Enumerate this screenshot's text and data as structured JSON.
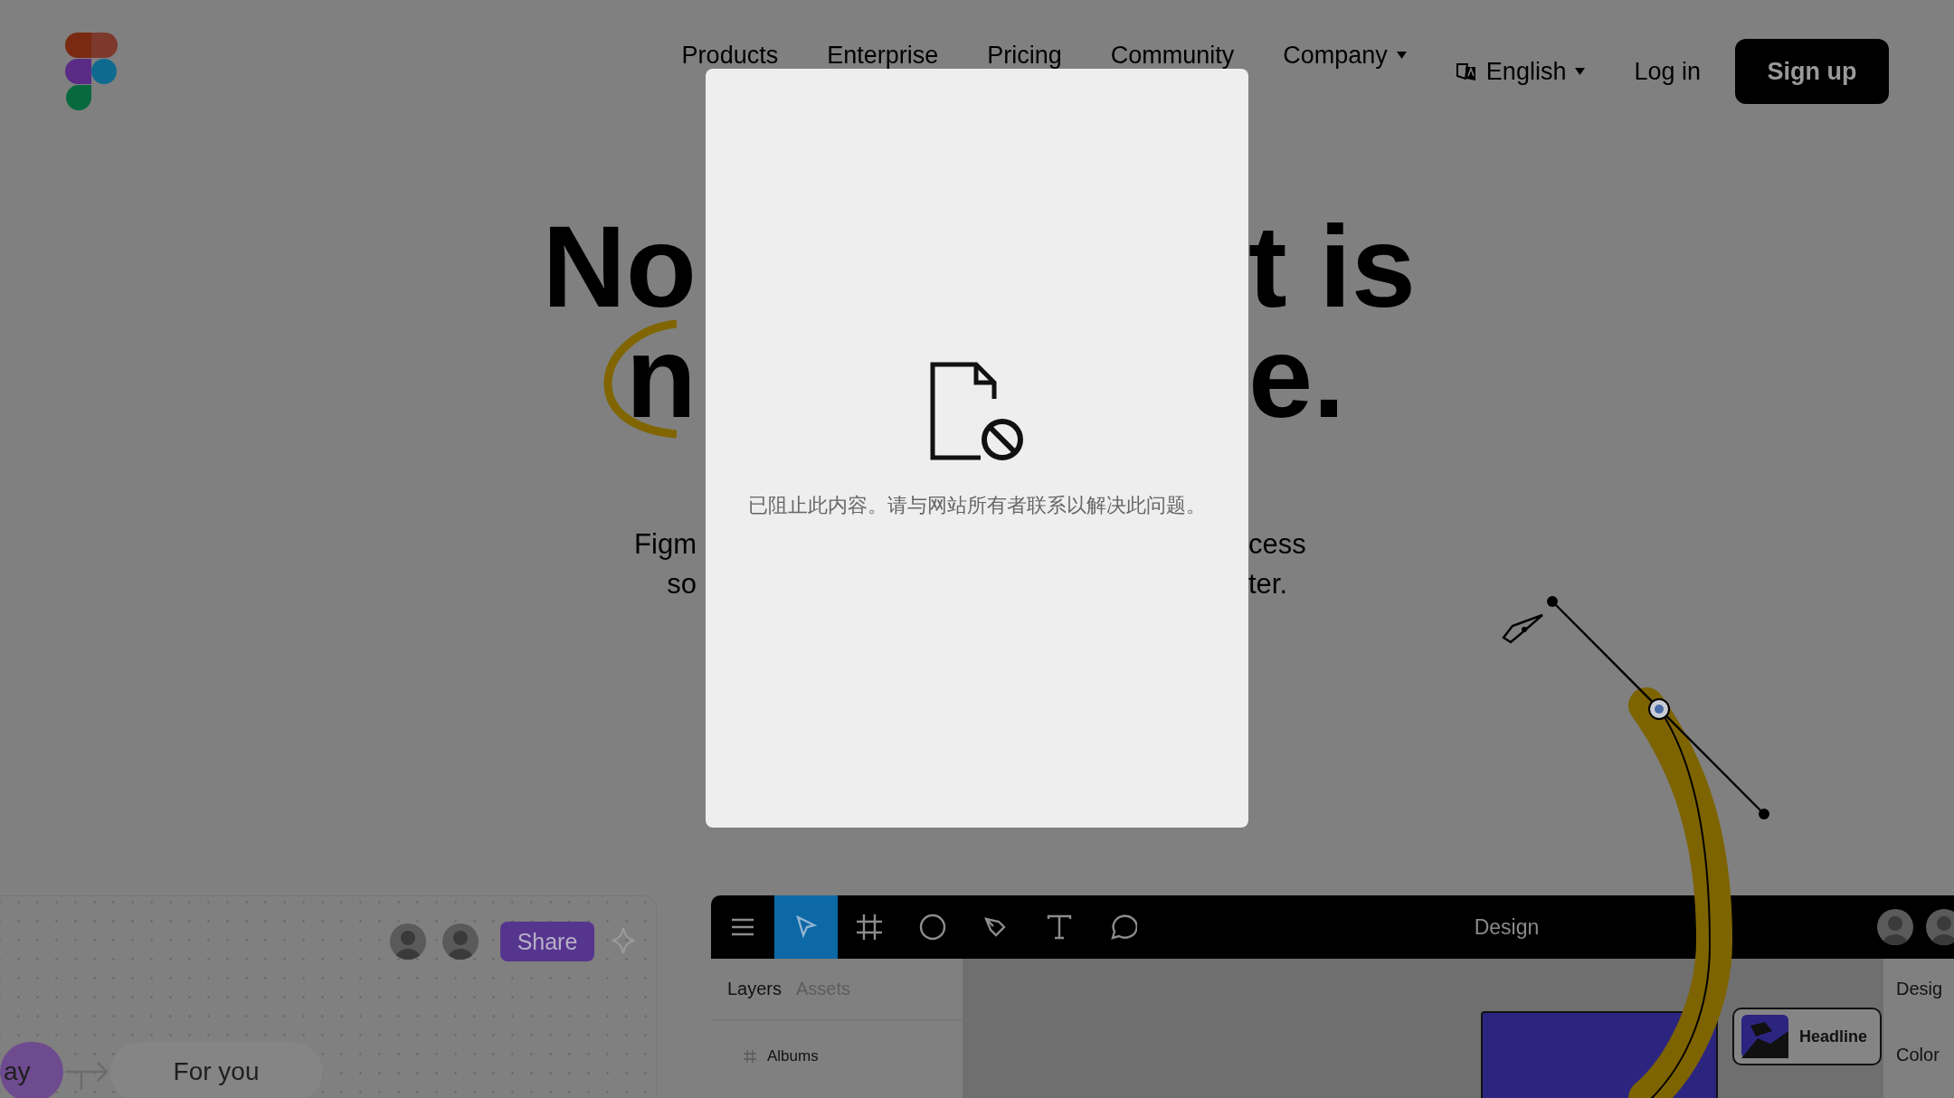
{
  "nav": {
    "items": [
      {
        "label": "Products",
        "has_menu": false
      },
      {
        "label": "Enterprise",
        "has_menu": false
      },
      {
        "label": "Pricing",
        "has_menu": false
      },
      {
        "label": "Community",
        "has_menu": false
      },
      {
        "label": "Company",
        "has_menu": true
      }
    ],
    "language": "English",
    "login": "Log in",
    "signup": "Sign up"
  },
  "hero": {
    "heading_left": [
      "No",
      "n"
    ],
    "heading_right": [
      "t is",
      "e."
    ],
    "body_left": [
      "Figm",
      "so"
    ],
    "body_right": [
      "cess",
      "ter."
    ]
  },
  "blocked_notice": {
    "message": "已阻止此内容。请与网站所有者联系以解决此问题。"
  },
  "board": {
    "share": "Share",
    "pills": [
      {
        "label": "ay",
        "selected": true
      },
      {
        "label": "For you",
        "selected": false
      }
    ]
  },
  "editor": {
    "tools": [
      {
        "kind": "menu",
        "selected": false
      },
      {
        "kind": "move",
        "selected": true
      },
      {
        "kind": "frame",
        "selected": false
      },
      {
        "kind": "ellipse",
        "selected": false
      },
      {
        "kind": "pen",
        "selected": false
      },
      {
        "kind": "text",
        "selected": false
      },
      {
        "kind": "comment",
        "selected": false
      }
    ],
    "title": "Design",
    "panel_tabs": [
      {
        "label": "Layers",
        "selected": true
      },
      {
        "label": "Assets",
        "selected": false
      }
    ],
    "layers": [
      "Albums"
    ],
    "component_label": "Headline",
    "right_panel": {
      "title": "Desig",
      "section": "Color"
    }
  }
}
